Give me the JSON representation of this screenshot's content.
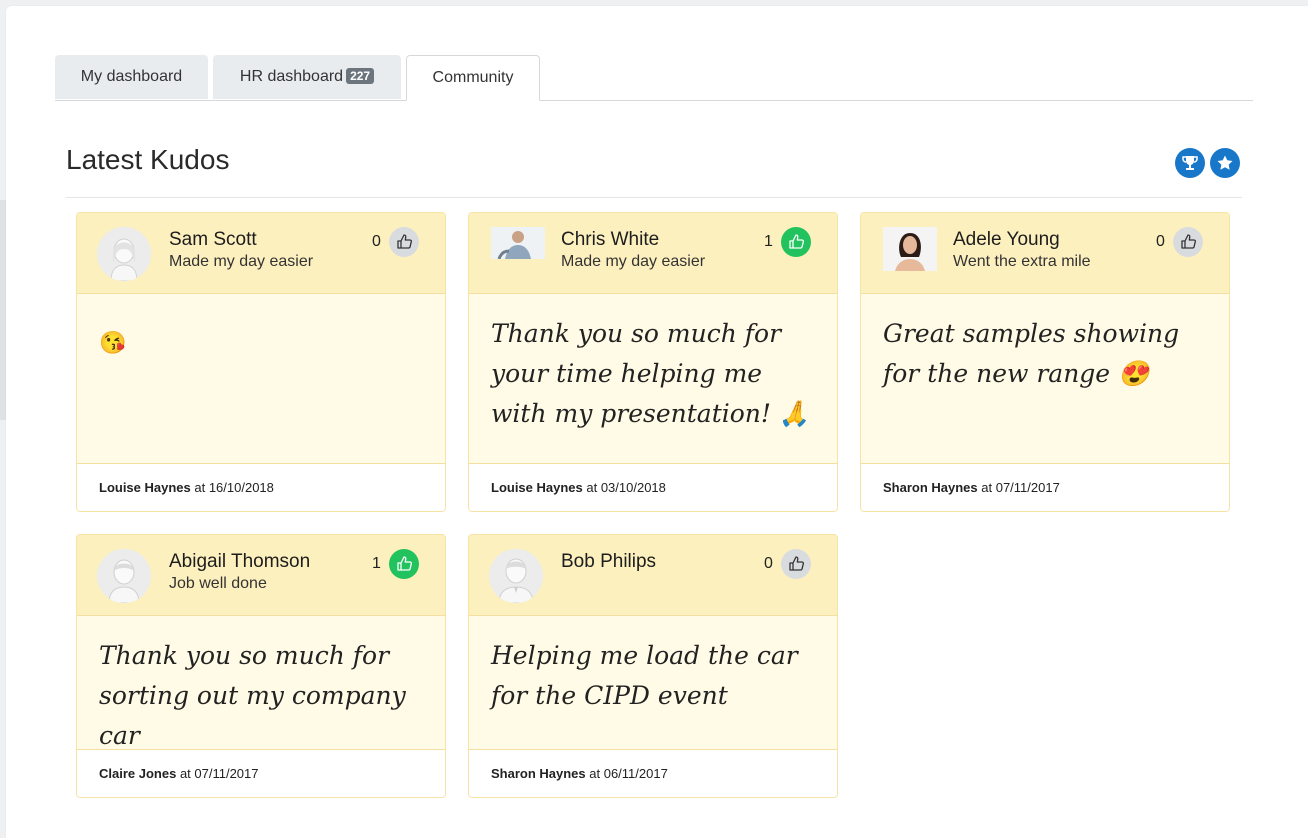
{
  "tabs": [
    {
      "label": "My dashboard"
    },
    {
      "label": "HR dashboard",
      "badge": "227"
    },
    {
      "label": "Community",
      "active": true
    }
  ],
  "section": {
    "title": "Latest Kudos"
  },
  "actions": {
    "trophy_icon": "trophy-icon",
    "star_icon": "star-icon",
    "color": "#1877c9"
  },
  "kudos": [
    {
      "name": "Sam Scott",
      "reason": "Made my day easier",
      "likes": "0",
      "liked": false,
      "message": "😘",
      "from": "Louise Haynes",
      "date_text": " at 16/10/2018"
    },
    {
      "name": "Chris White",
      "reason": "Made my day easier",
      "likes": "1",
      "liked": true,
      "message": "Thank you so much for your time helping me with my presentation! 🙏",
      "from": "Louise Haynes",
      "date_text": " at 03/10/2018"
    },
    {
      "name": "Adele Young",
      "reason": "Went the extra mile",
      "likes": "0",
      "liked": false,
      "message": "Great samples showing for the new range 😍",
      "from": "Sharon Haynes",
      "date_text": " at 07/11/2017"
    },
    {
      "name": "Abigail Thomson",
      "reason": "Job well done",
      "likes": "1",
      "liked": true,
      "message": "Thank you so much for sorting out my company car",
      "from": "Claire Jones",
      "date_text": " at 07/11/2017"
    },
    {
      "name": "Bob Philips",
      "reason": "",
      "likes": "0",
      "liked": false,
      "message": "Helping me load the car for the CIPD event",
      "from": "Sharon Haynes",
      "date_text": " at 06/11/2017"
    }
  ],
  "colors": {
    "liked": "#22c35e",
    "unliked": "#d9dcdf",
    "card_header": "#fdf0bf",
    "card_body": "#fffbe6"
  }
}
